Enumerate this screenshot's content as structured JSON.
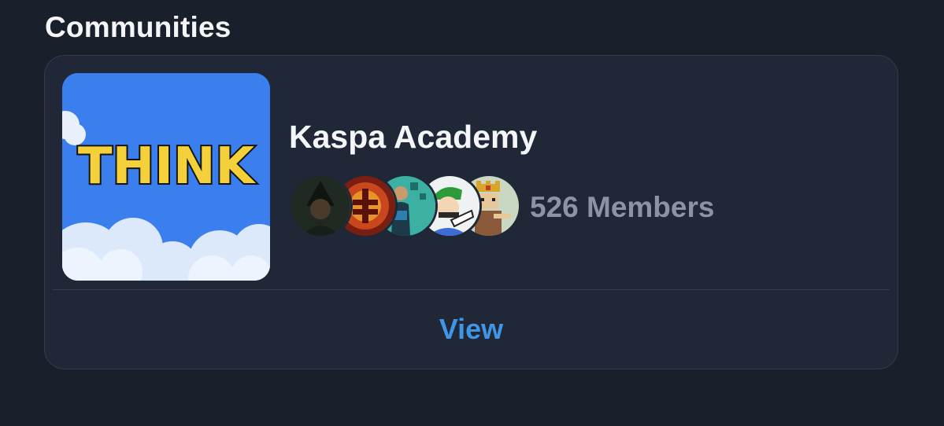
{
  "section": {
    "title": "Communities"
  },
  "community": {
    "name": "Kaspa Academy",
    "cover_text": "THINK",
    "members_label": "526 Members",
    "avatars": [
      {
        "icon": "wizard-avatar-icon",
        "color": "#203124"
      },
      {
        "icon": "red-emblem-avatar-icon",
        "color": "#b8401c"
      },
      {
        "icon": "person-avatar-icon",
        "color": "#3fb3a5"
      },
      {
        "icon": "cartoon-avatar-icon",
        "color": "#e8edf0"
      },
      {
        "icon": "pixel-king-avatar-icon",
        "color": "#c9d6c0"
      }
    ],
    "view_label": "View"
  },
  "colors": {
    "background": "#1a202b",
    "card": "#202837",
    "accent": "#3f95e6",
    "muted_text": "#8a94a3"
  }
}
